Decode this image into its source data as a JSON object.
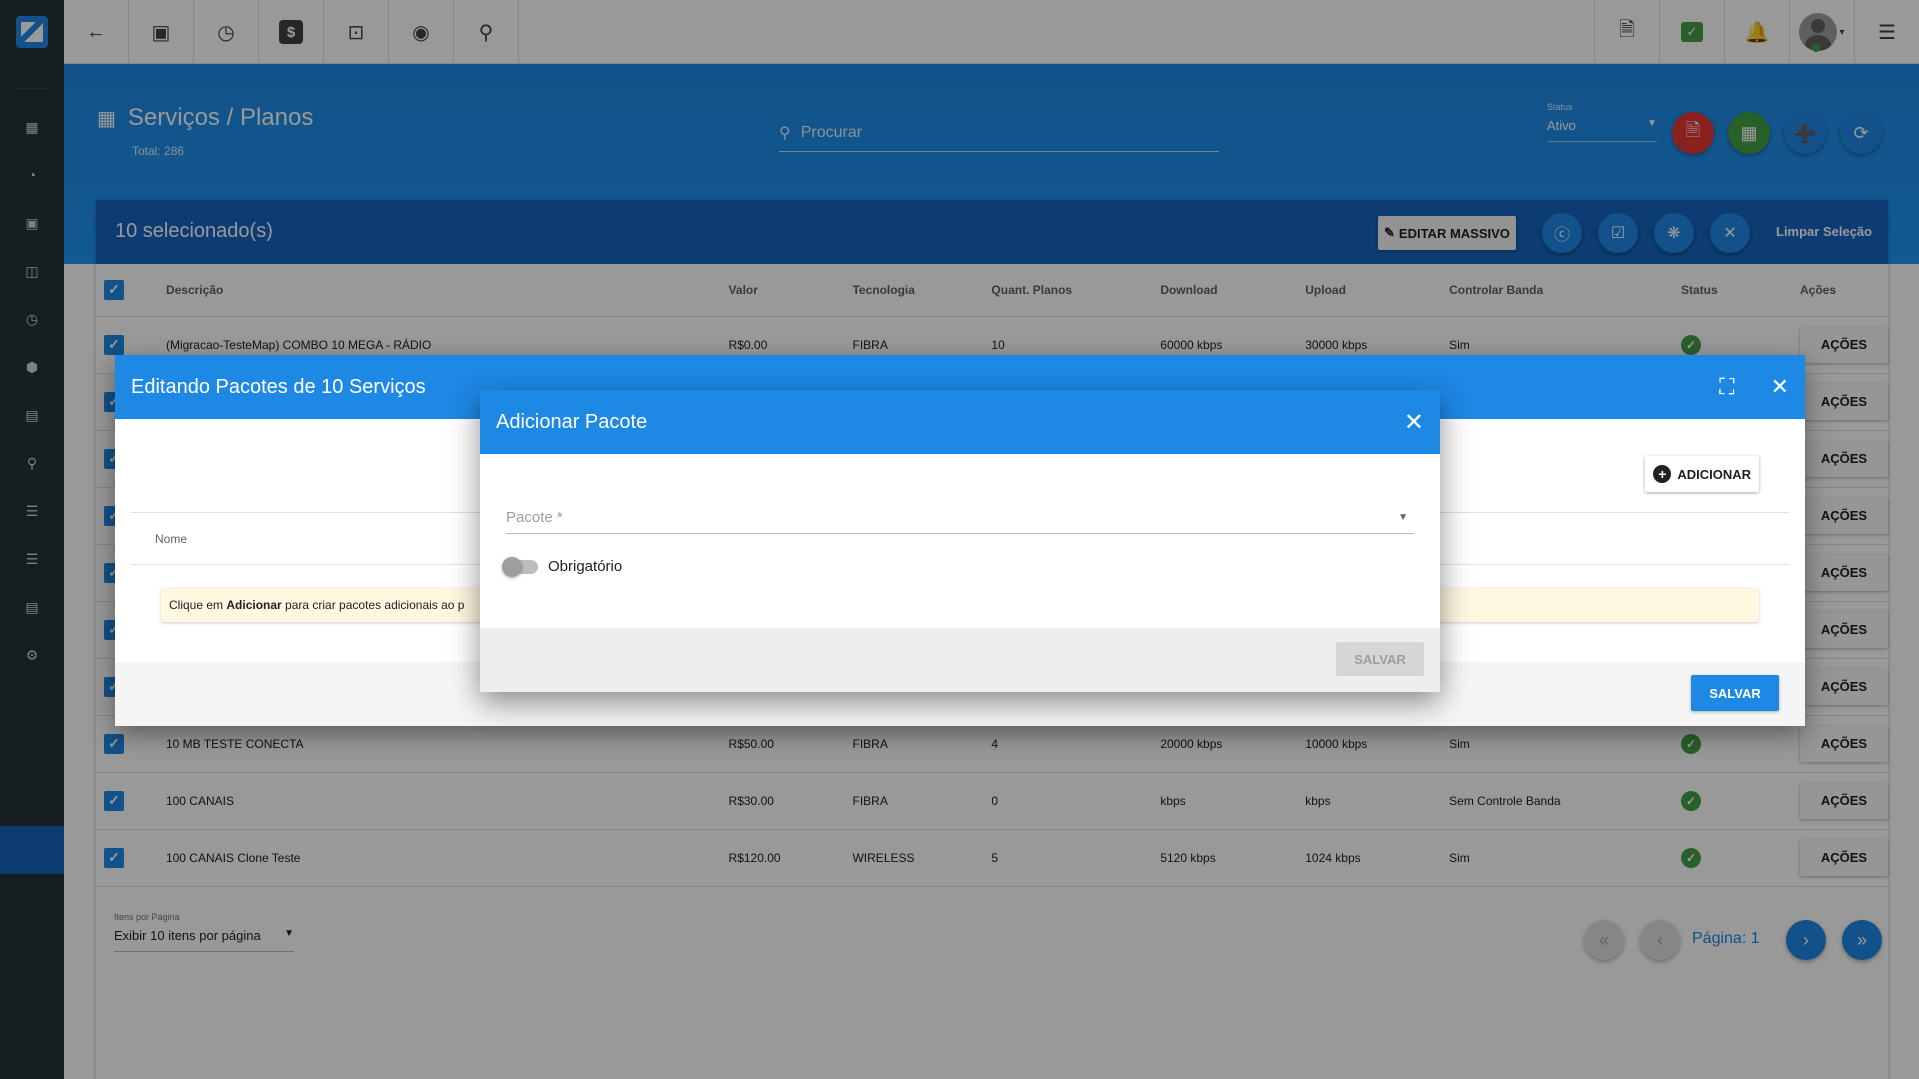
{
  "topbar": {
    "left_icons": [
      "back-arrow-icon",
      "contact-card-icon",
      "calendar-clock-icon",
      "dollar-icon",
      "terminal-icon",
      "eye-icon",
      "search-icon"
    ],
    "right_icons": [
      "pdf-file-icon",
      "chat-check-icon",
      "bell-icon",
      "avatar",
      "menu-icon"
    ]
  },
  "sidebar": {
    "icons": [
      "dashboard-icon",
      "pie-chart-icon",
      "contacts-icon",
      "book-icon",
      "history-icon",
      "box-icon",
      "money-icon",
      "location-icon",
      "list-icon",
      "storage-icon",
      "document-icon",
      "settings-icon"
    ]
  },
  "header": {
    "title": "Serviços / Planos",
    "total": "Total: 286",
    "search_placeholder": "Procurar",
    "status_label": "Status",
    "status_value": "Ativo"
  },
  "selection_bar": {
    "count": "10 selecionado(s)",
    "edit_label": "EDITAR MASSIVO",
    "clear_label": "Limpar Seleção"
  },
  "table": {
    "headers": [
      "Descrição",
      "Valor",
      "Tecnologia",
      "Quant. Planos",
      "Download",
      "Upload",
      "Controlar Banda",
      "Status",
      "Ações"
    ],
    "action_label": "AÇÕES",
    "rows": [
      {
        "descricao": "(Migracao-TesteMap) COMBO 10 MEGA - RÁDIO",
        "valor": "R$0.00",
        "tecnologia": "FIBRA",
        "quant": "10",
        "download": "60000 kbps",
        "upload": "30000 kbps",
        "banda": "Sim"
      },
      {
        "descricao": "",
        "valor": "",
        "tecnologia": "",
        "quant": "",
        "download": "",
        "upload": "",
        "banda": ""
      },
      {
        "descricao": "",
        "valor": "",
        "tecnologia": "",
        "quant": "",
        "download": "",
        "upload": "",
        "banda": ""
      },
      {
        "descricao": "",
        "valor": "",
        "tecnologia": "",
        "quant": "",
        "download": "",
        "upload": "",
        "banda": ""
      },
      {
        "descricao": "",
        "valor": "",
        "tecnologia": "",
        "quant": "",
        "download": "",
        "upload": "",
        "banda": ""
      },
      {
        "descricao": "",
        "valor": "",
        "tecnologia": "",
        "quant": "",
        "download": "",
        "upload": "",
        "banda": ""
      },
      {
        "descricao": "",
        "valor": "",
        "tecnologia": "",
        "quant": "",
        "download": "",
        "upload": "",
        "banda": ""
      },
      {
        "descricao": "10 MB TESTE CONECTA",
        "valor": "R$50.00",
        "tecnologia": "FIBRA",
        "quant": "4",
        "download": "20000 kbps",
        "upload": "10000 kbps",
        "banda": "Sim"
      },
      {
        "descricao": "100 CANAIS",
        "valor": "R$30.00",
        "tecnologia": "FIBRA",
        "quant": "0",
        "download": "kbps",
        "upload": "kbps",
        "banda": "Sem Controle Banda"
      },
      {
        "descricao": "100 CANAIS Clone Teste",
        "valor": "R$120.00",
        "tecnologia": "WIRELESS",
        "quant": "5",
        "download": "5120 kbps",
        "upload": "1024 kbps",
        "banda": "Sim"
      }
    ]
  },
  "pagination": {
    "items_label": "Itens por Página",
    "items_value": "Exibir 10 itens por página",
    "page_text": "Página: 1"
  },
  "dialog_outer": {
    "title": "Editando Pacotes de 10 Serviços",
    "add_label": "ADICIONAR",
    "col_nome": "Nome",
    "hint_pre": "Clique em ",
    "hint_bold": "Adicionar",
    "hint_post": " para criar pacotes adicionais ao p",
    "save_label": "SALVAR"
  },
  "dialog_inner": {
    "title": "Adicionar Pacote",
    "pacote_placeholder": "Pacote *",
    "toggle_label": "Obrigatório",
    "toggle_on": false,
    "save_label": "SALVAR"
  },
  "colors": {
    "primary": "#1e88e5",
    "dark_primary": "#1565c0",
    "sidebar": "#263238",
    "success": "#43a047",
    "pdf_red": "#e53935",
    "excel_green": "#43a047"
  }
}
